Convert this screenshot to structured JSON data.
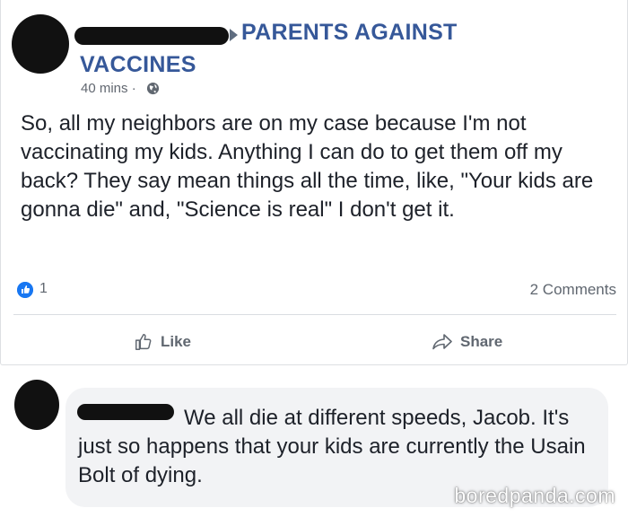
{
  "post": {
    "group_name": "PARENTS AGAINST VACCINES",
    "timestamp": "40 mins · ",
    "body": "So, all my neighbors are on my case because I'm not vaccinating my kids. Anything I can do to get them off my back? They say mean things all the time, like, \"Your kids are gonna die\" and, \"Science is real\" I don't get it.",
    "like_count": "1",
    "comments_count": "2 Comments",
    "like_label": "Like",
    "share_label": "Share",
    "privacy_icon": "globe-icon"
  },
  "comment": {
    "text": "We all die at different speeds, Jacob. It's just so happens that your kids are currently the Usain Bolt of dying."
  },
  "watermark": "boredpanda.com",
  "colors": {
    "group_link": "#365899",
    "like_blue": "#1877f2",
    "meta_gray": "#606770",
    "bubble_bg": "#f2f3f5"
  }
}
